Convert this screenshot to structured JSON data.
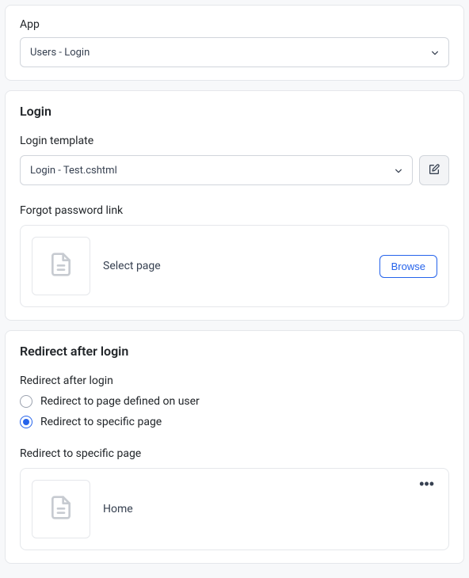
{
  "app": {
    "label": "App",
    "selected": "Users - Login"
  },
  "login": {
    "title": "Login",
    "template_label": "Login template",
    "template_selected": "Login - Test.cshtml",
    "forgot_label": "Forgot password link",
    "forgot_page_text": "Select page",
    "browse_label": "Browse"
  },
  "redirect": {
    "title": "Redirect after login",
    "group_label": "Redirect after login",
    "option_user": "Redirect to page defined on user",
    "option_specific": "Redirect to specific page",
    "selected_option": "specific",
    "specific_label": "Redirect to specific page",
    "specific_page_text": "Home"
  }
}
